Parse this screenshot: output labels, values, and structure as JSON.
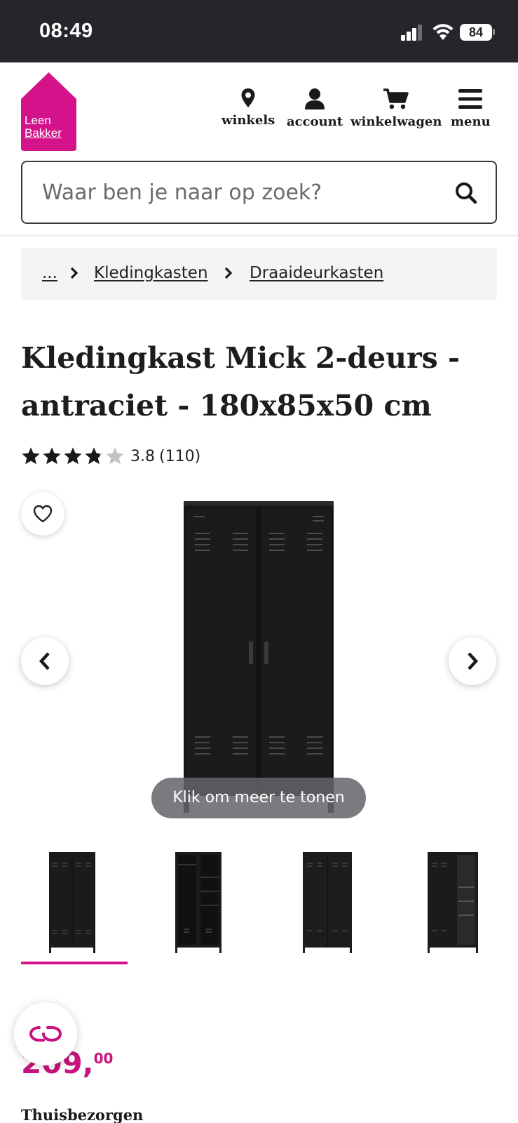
{
  "status_bar": {
    "time": "08:49",
    "battery": "84"
  },
  "brand": {
    "logo_line1": "Leen",
    "logo_line2": "Bakker",
    "primary_color": "#d4138a"
  },
  "nav": {
    "stores_label": "winkels",
    "account_label": "account",
    "cart_label": "winkelwagen",
    "menu_label": "menu"
  },
  "search": {
    "placeholder": "Waar ben je naar op zoek?"
  },
  "breadcrumb": {
    "ellipsis": "...",
    "items": [
      "Kledingkasten",
      "Draaideurkasten"
    ]
  },
  "product": {
    "title": "Kledingkast Mick 2-deurs - antraciet - 180x85x50 cm",
    "rating_value": "3.8",
    "rating_count": "(110)",
    "rating": 3.8,
    "price_main": "209,",
    "price_cents": "00",
    "price_color": "#c8127f"
  },
  "gallery": {
    "more_label": "Klik om meer te tonen",
    "thumbnail_count": 4,
    "active_thumbnail": 1
  },
  "delivery": {
    "heading": "Thuisbezorgen"
  },
  "icons": [
    "location-pin-icon",
    "user-icon",
    "cart-icon",
    "hamburger-menu-icon",
    "search-icon",
    "chevron-right-icon",
    "star-icon",
    "heart-icon",
    "chevron-left-icon",
    "chat-icon"
  ]
}
